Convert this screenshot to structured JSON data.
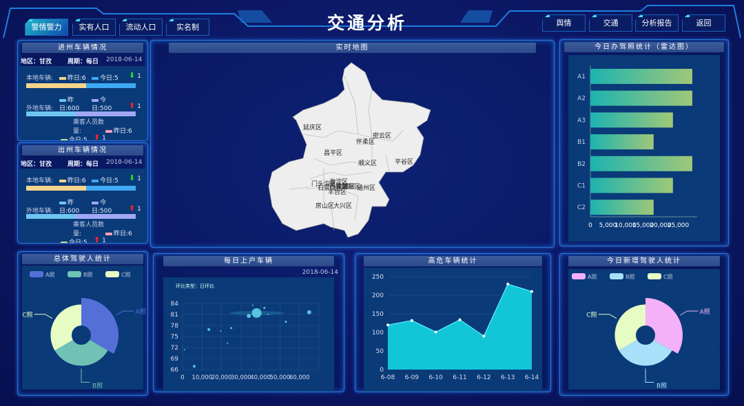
{
  "header": {
    "title": "交通分析",
    "left_tabs": [
      {
        "label": "警情警力",
        "active": true
      },
      {
        "label": "实有人口"
      },
      {
        "label": "流动人口"
      },
      {
        "label": "实名制"
      }
    ],
    "right_tabs": [
      {
        "label": "舆情"
      },
      {
        "label": "交通"
      },
      {
        "label": "分析报告"
      },
      {
        "label": "返回"
      }
    ]
  },
  "colors": {
    "accent": "#2a78d8",
    "yesterday_local": "#f5d58a",
    "today_local": "#3fa9f5",
    "yesterday_out": "#6ec6f0",
    "today_out": "#a0a8f5",
    "passenger_yesterday": "#f4a0b8",
    "passenger_today": "#c8e08a",
    "up": "#ff2020",
    "down": "#22dd22"
  },
  "inbound": {
    "title": "进州车辆情况",
    "region": "地区：甘孜",
    "period": "周期：每日",
    "date": "2018-06-14",
    "local": {
      "label": "本地车辆:",
      "yesterday": "昨日:6",
      "today": "今日:5",
      "change": "1",
      "direction": "down",
      "y": 6,
      "t": 5
    },
    "outside": {
      "label": "外地车辆:",
      "yesterday_a": "昨",
      "yesterday_b": "日:600",
      "today_a": "今",
      "today_b": "日:500",
      "change": "1",
      "direction": "up",
      "y": 600,
      "t": 500
    },
    "passenger": {
      "label_a": "乘客人员数",
      "label_b": "量:",
      "yesterday": "昨日:6",
      "today": "今日:5",
      "change": "1",
      "direction": "up"
    }
  },
  "outbound": {
    "title": "出州车辆情况",
    "region": "地区：甘孜",
    "period": "周期：每日",
    "date": "2018-06-14",
    "local": {
      "label": "本地车辆:",
      "yesterday": "昨日:6",
      "today": "今日:5",
      "change": "1",
      "direction": "down",
      "y": 6,
      "t": 5
    },
    "outside": {
      "label": "外地车辆:",
      "yesterday_a": "昨",
      "yesterday_b": "日:600",
      "today_a": "今",
      "today_b": "日:500",
      "change": "1",
      "direction": "up",
      "y": 600,
      "t": 500
    },
    "passenger": {
      "label_a": "乘客人员数",
      "label_b": "量:",
      "yesterday": "昨日:6",
      "today": "今日:5",
      "change": "1",
      "direction": "up"
    }
  },
  "map": {
    "title": "实时地图",
    "districts": [
      "延庆区",
      "密云区",
      "怀柔区",
      "昌平区",
      "顺义区",
      "平谷区",
      "门头沟区",
      "海淀区",
      "石景山区",
      "西城区",
      "东城区",
      "朝阳区",
      "丰台区",
      "通州区",
      "房山区",
      "大兴区"
    ]
  },
  "chart_data": [
    {
      "id": "drivers_total",
      "type": "pie",
      "rose": true,
      "title": "总体驾驶人统计",
      "categories": [
        "A照",
        "B照",
        "C照"
      ],
      "values": [
        40,
        33,
        33
      ],
      "colors": [
        "#5470d8",
        "#6fc2b4",
        "#e6fcc4"
      ],
      "legend": "top-left"
    },
    {
      "id": "daily_accounts",
      "type": "scatter",
      "title": "每日上户车辆",
      "date": "2018-06-14",
      "subtitle": "环比类型：日环比",
      "xlim": [
        0,
        70000
      ],
      "ylim": [
        66,
        84
      ],
      "xticks": [
        "0",
        "10,000",
        "20,000",
        "30,000",
        "40,000",
        "50,000",
        "60,000"
      ],
      "yticks": [
        "66",
        "69",
        "72",
        "75",
        "78",
        "81",
        "84"
      ],
      "grid": true,
      "points": [
        [
          1000,
          71.4,
          1
        ],
        [
          6000,
          66.9,
          2
        ],
        [
          13500,
          76.9,
          2
        ],
        [
          19500,
          76.5,
          1
        ],
        [
          23000,
          73.2,
          1
        ],
        [
          25000,
          77.3,
          1.5
        ],
        [
          34000,
          80.6,
          3
        ],
        [
          36000,
          83.5,
          1
        ],
        [
          38000,
          81.4,
          7
        ],
        [
          42000,
          82.8,
          1.5
        ],
        [
          44000,
          81,
          1
        ],
        [
          53000,
          79,
          1.5
        ],
        [
          65000,
          81.6,
          3
        ]
      ]
    },
    {
      "id": "high_risk",
      "type": "area",
      "title": "高危车辆统计",
      "categories": [
        "6-08",
        "6-09",
        "6-10",
        "6-11",
        "6-12",
        "6-13",
        "6-14"
      ],
      "values": [
        120,
        132,
        101,
        134,
        90,
        230,
        210
      ],
      "ylim": [
        0,
        250
      ],
      "yticks": [
        "0",
        "50",
        "100",
        "150",
        "200",
        "250"
      ],
      "grid": true,
      "color": "#12c6d8"
    },
    {
      "id": "license_today",
      "type": "bar",
      "orientation": "horizontal",
      "title": "今日办驾照统计（雷达图）",
      "categories": [
        "A1",
        "A2",
        "A3",
        "B1",
        "B2",
        "C1",
        "C2"
      ],
      "values": [
        29000,
        29000,
        23500,
        18000,
        29000,
        23500,
        18000
      ],
      "xlim": [
        0,
        30000
      ],
      "xticks": [
        "0",
        "5,000",
        "10,000",
        "15,000",
        "20,000",
        "25,000"
      ],
      "colors": [
        "#1db3b0",
        "#a0c878"
      ]
    },
    {
      "id": "drivers_new",
      "type": "pie",
      "rose": true,
      "title": "今日新增驾驶人统计",
      "categories": [
        "A照",
        "B照",
        "C照"
      ],
      "values": [
        40,
        33,
        33
      ],
      "colors": [
        "#f4b0f8",
        "#a8e0fa",
        "#e6fcc4"
      ],
      "legend": "top-left"
    }
  ]
}
